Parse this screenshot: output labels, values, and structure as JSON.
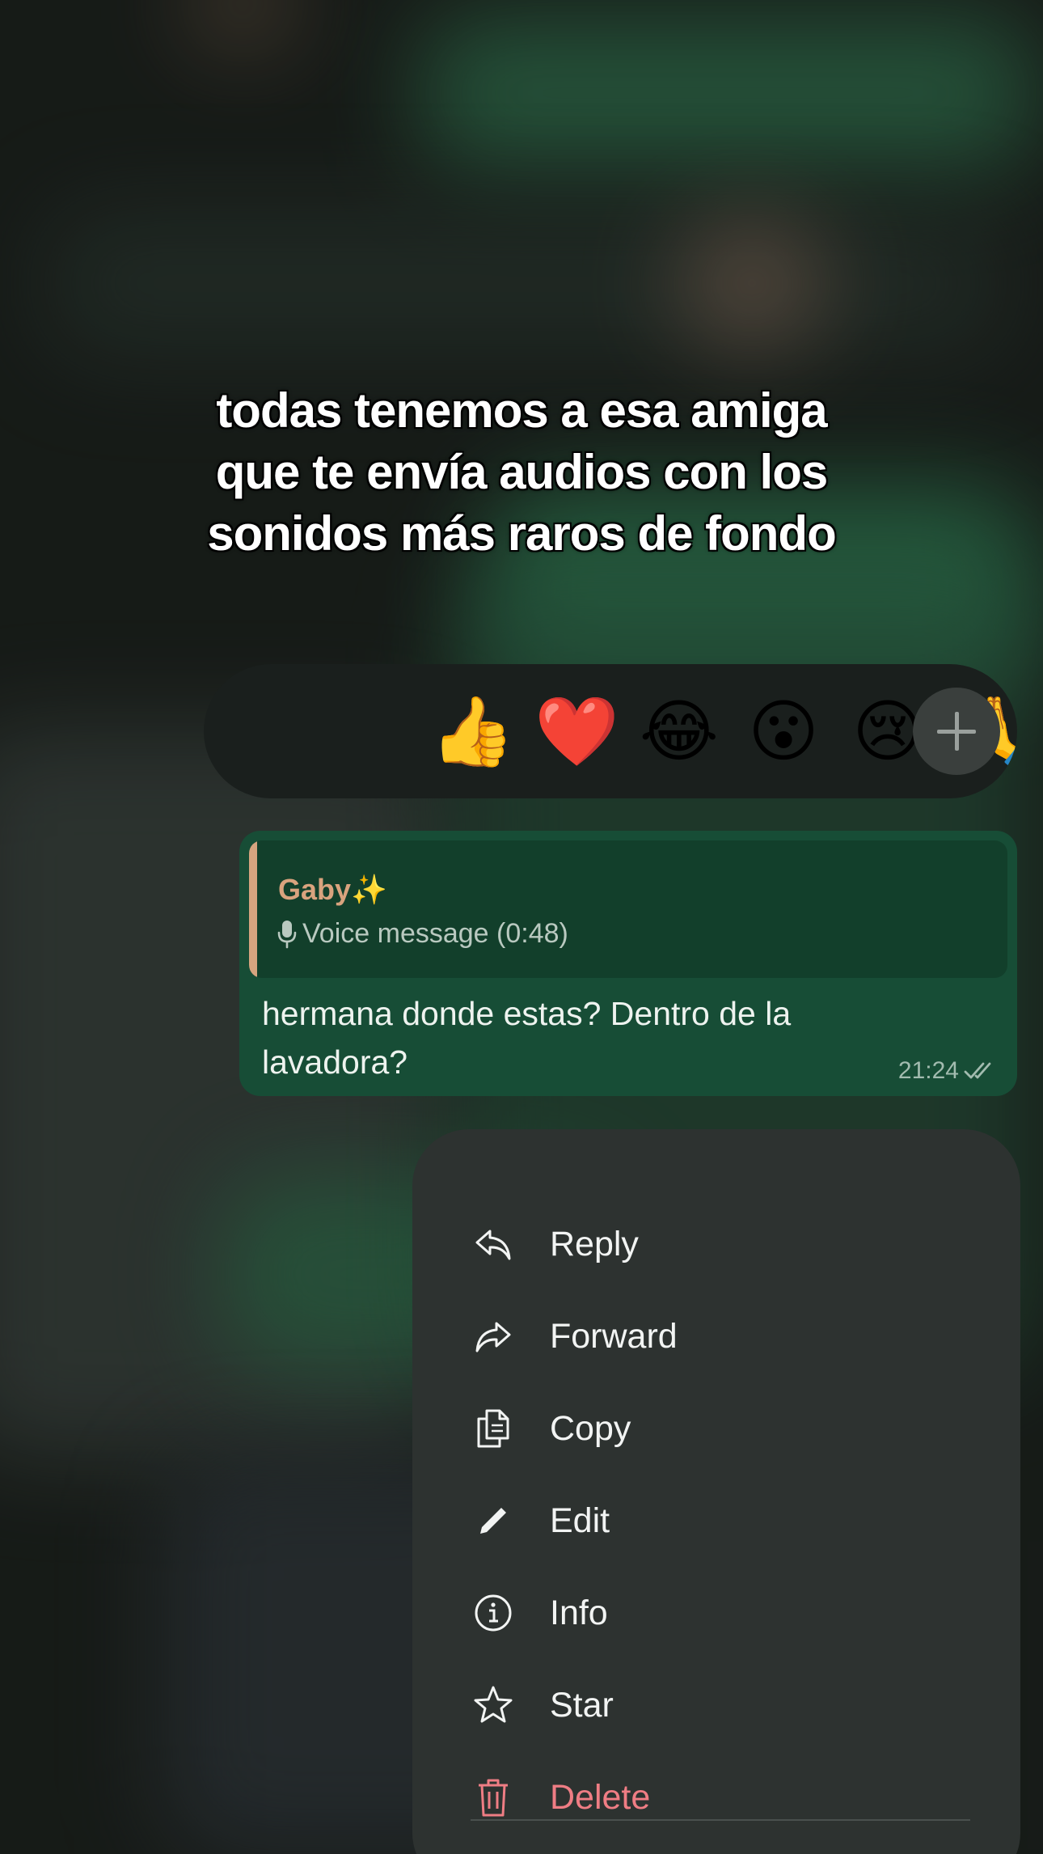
{
  "caption": {
    "lines": [
      "todas tenemos a esa amiga",
      "que te envía audios con los",
      "sonidos más raros de fondo"
    ]
  },
  "reactions": {
    "emojis": [
      "👍",
      "❤️",
      "😂",
      "😮",
      "😢",
      "🙏",
      "🧚"
    ],
    "more_icon": "plus-icon"
  },
  "message": {
    "quote": {
      "author": "Gaby✨",
      "icon": "microphone-icon",
      "text": "Voice message (0:48)"
    },
    "text": "hermana donde estas? Dentro de la lavadora?",
    "time": "21:24",
    "status_icon": "double-check-icon"
  },
  "menu": {
    "items": [
      {
        "label": "Reply",
        "icon": "reply-icon"
      },
      {
        "label": "Forward",
        "icon": "forward-icon"
      },
      {
        "label": "Copy",
        "icon": "copy-icon"
      },
      {
        "label": "Edit",
        "icon": "pencil-icon"
      },
      {
        "label": "Info",
        "icon": "info-icon"
      },
      {
        "label": "Star",
        "icon": "star-icon"
      },
      {
        "label": "Delete",
        "icon": "trash-icon",
        "color": "#ef7d84"
      }
    ]
  },
  "colors": {
    "bubble": "#174d36",
    "quote_bg": "#123f2b",
    "quote_accent": "#d6a47f",
    "menu_bg": "#2d3230",
    "danger": "#ef7d84"
  }
}
